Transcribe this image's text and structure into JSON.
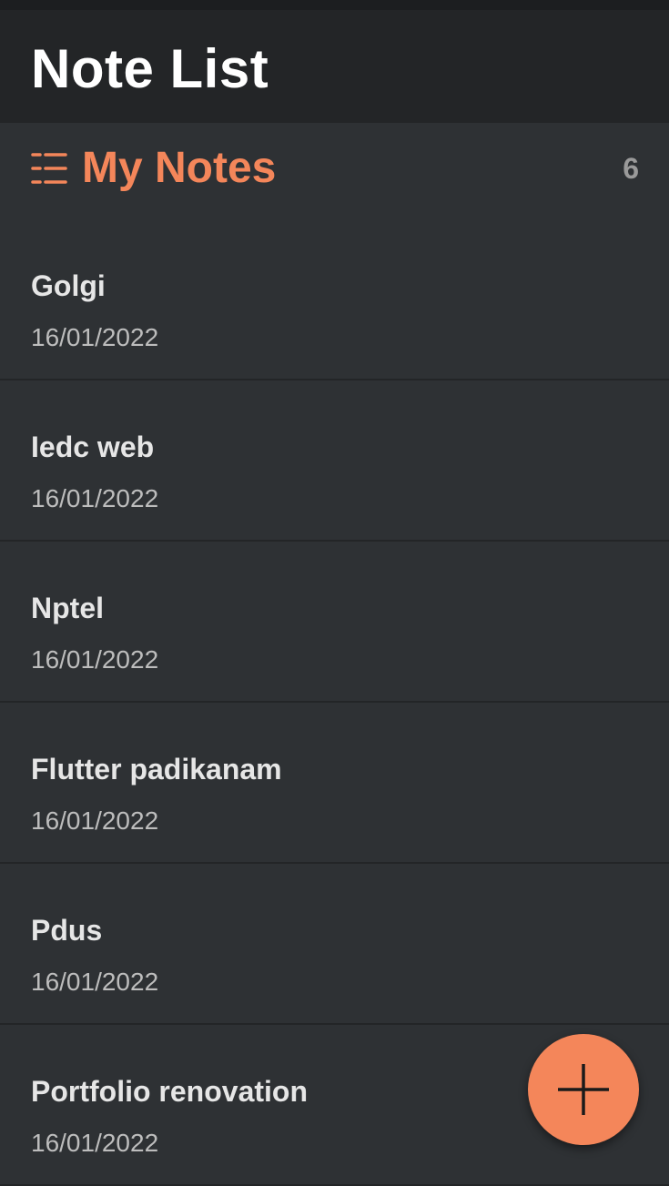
{
  "appbar": {
    "title": "Note List"
  },
  "section": {
    "title": "My Notes",
    "count": "6",
    "icon": "list-icon"
  },
  "notes": [
    {
      "title": "Golgi",
      "date": "16/01/2022"
    },
    {
      "title": "Iedc web",
      "date": "16/01/2022"
    },
    {
      "title": "Nptel",
      "date": "16/01/2022"
    },
    {
      "title": "Flutter padikanam",
      "date": "16/01/2022"
    },
    {
      "title": "Pdus",
      "date": "16/01/2022"
    },
    {
      "title": "Portfolio renovation",
      "date": "16/01/2022"
    }
  ],
  "fab": {
    "icon": "plus-icon"
  },
  "colors": {
    "accent": "#f4865a",
    "background": "#2e3134",
    "appbar": "#232527",
    "title_text": "#ffffff",
    "item_title": "#e6e6e6",
    "item_date": "#bdbdbd",
    "count": "#9a9a9a"
  }
}
